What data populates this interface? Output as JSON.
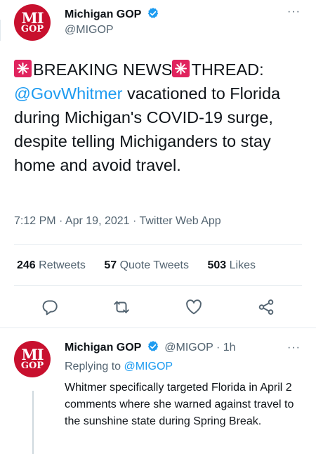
{
  "main_tweet": {
    "author_name": "Michigan GOP",
    "handle": "@MIGOP",
    "avatar_text_top": "MI",
    "avatar_text_bottom": "GOP",
    "text_part1": "BREAKING NEWS",
    "text_part2": "THREAD:",
    "mention": "@GovWhitmer",
    "text_rest": " vacationed to Florida during Michigan's COVID-19 surge, despite telling Michiganders to stay home and avoid travel.",
    "timestamp": "7:12 PM · Apr 19, 2021 · Twitter Web App",
    "stats": {
      "retweets_count": "246",
      "retweets_label": "Retweets",
      "quote_count": "57",
      "quote_label": "Quote Tweets",
      "likes_count": "503",
      "likes_label": "Likes"
    },
    "more_label": "···"
  },
  "reply_tweet": {
    "author_name": "Michigan GOP",
    "handle": "@MIGOP",
    "time": "· 1h",
    "replying_prefix": "Replying to ",
    "replying_handle": "@MIGOP",
    "text": "Whitmer specifically targeted Florida in April 2 comments where she warned against travel to the sunshine state during Spring Break.",
    "more_label": "···"
  },
  "icons": [
    "verified-icon",
    "siren-emoji-icon",
    "reply-icon",
    "retweet-icon",
    "like-icon",
    "share-icon"
  ],
  "colors": {
    "accent": "#1d9bf0",
    "avatar_red": "#c8102e",
    "siren_red": "#e0245e",
    "secondary_text": "#536471"
  }
}
